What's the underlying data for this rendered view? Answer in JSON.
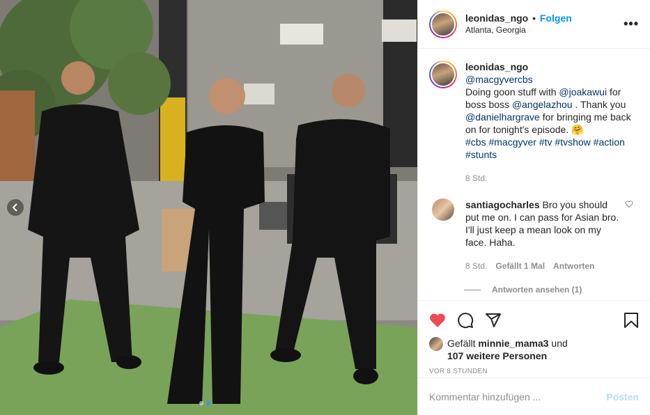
{
  "post": {
    "username": "leonidas_ngo",
    "separator": "•",
    "follow_label": "Folgen",
    "location": "Atlanta, Georgia",
    "more_icon": "more-options-icon"
  },
  "caption": {
    "username": "leonidas_ngo",
    "mention_1": "@macgyvercbs",
    "text_1": "Doing goon stuff with",
    "mention_2": "@joakawui",
    "text_2": "for boss boss",
    "mention_3": "@angelazhou",
    "text_3": ". Thank you",
    "mention_4": "@danielhargrave",
    "text_4": "for bringing me back on for tonight's episode. 🤗",
    "hashtags": [
      "#cbs",
      "#macgyver",
      "#tv",
      "#tvshow",
      "#action",
      "#stunts"
    ],
    "age": "8 Std."
  },
  "comment": {
    "username": "santiagocharles",
    "text": "Bro you should put me on. I can pass for Asian bro. I'll just keep a mean look on my face. Haha.",
    "age": "8 Std.",
    "likes_label": "Gefällt 1 Mal",
    "reply_label": "Antworten",
    "view_replies_label": "Antworten ansehen (1)"
  },
  "actions": {
    "liked_by_prefix": "Gefällt",
    "liked_by_user": "minnie_mama3",
    "liked_by_and": "und",
    "others_label": "107 weitere Personen",
    "timestamp": "VOR 8 STUNDEN",
    "like_color": "#ed4956"
  },
  "add_comment": {
    "placeholder": "Kommentar hinzufügen ...",
    "post_label": "Posten"
  },
  "carousel": {
    "slide_count": 2,
    "active_slide": 1,
    "accent": "#3897f0"
  }
}
